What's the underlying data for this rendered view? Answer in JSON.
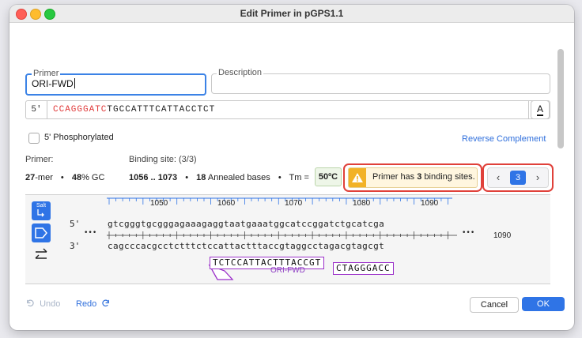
{
  "window": {
    "title": "Edit Primer in pGPS1.1"
  },
  "primer": {
    "legend": "Primer",
    "value": "ORI-FWD"
  },
  "description": {
    "legend": "Description",
    "value": ""
  },
  "sequence": {
    "end5": "5'",
    "end3": "3'",
    "red_part": "CCAGGGATC",
    "rest": "TGCCATTTCATTACCTCT",
    "font_button": "A"
  },
  "phosphorylated": {
    "label": "5' Phosphorylated",
    "checked": false
  },
  "reverse_complement": "Reverse Complement",
  "stats": {
    "primer_label": "Primer:",
    "length": "27",
    "mer_suffix": "-mer",
    "bullet": "•",
    "gc": "48",
    "gc_suffix": "% GC",
    "binding_label": "Binding site: (3/3)",
    "range": "1056 .. 1073",
    "annealed_count": "18",
    "annealed_suffix": "Annealed bases",
    "tm_label": "Tm =",
    "tm_value": "50ºC"
  },
  "warning": {
    "prefix": "Primer has ",
    "count": "3",
    "suffix": " binding sites."
  },
  "navigation": {
    "current": "3",
    "prev_icon": "chevron-left-icon",
    "next_icon": "chevron-right-icon"
  },
  "viewer": {
    "ruler": [
      "1050",
      "1060",
      "1070",
      "1080",
      "1090"
    ],
    "top_strand_label": "5'",
    "bottom_strand_label": "3'",
    "top_seq": "gtcgggtgcgggagaaagaggtaatgaaatggcatccggatctgcatcga",
    "bottom_seq": "cagcccacgcctctttctccattactttaccgtaggcctagacgtagcgt",
    "ellipsis": "•••",
    "right_position": "1090",
    "primer_annealed": "TCTCCATTACTTTACCGT",
    "primer_overhang": "CTAGGGACC",
    "primer_name": "ORI-FWD",
    "salt_label": "Salt"
  },
  "footer": {
    "undo": "Undo",
    "redo": "Redo",
    "cancel": "Cancel",
    "ok": "OK"
  },
  "colors": {
    "accent": "#2f74e6",
    "warning_border": "#e0413a",
    "primer_purple": "#9b2fc9",
    "sequence_red": "#e03a3a"
  }
}
